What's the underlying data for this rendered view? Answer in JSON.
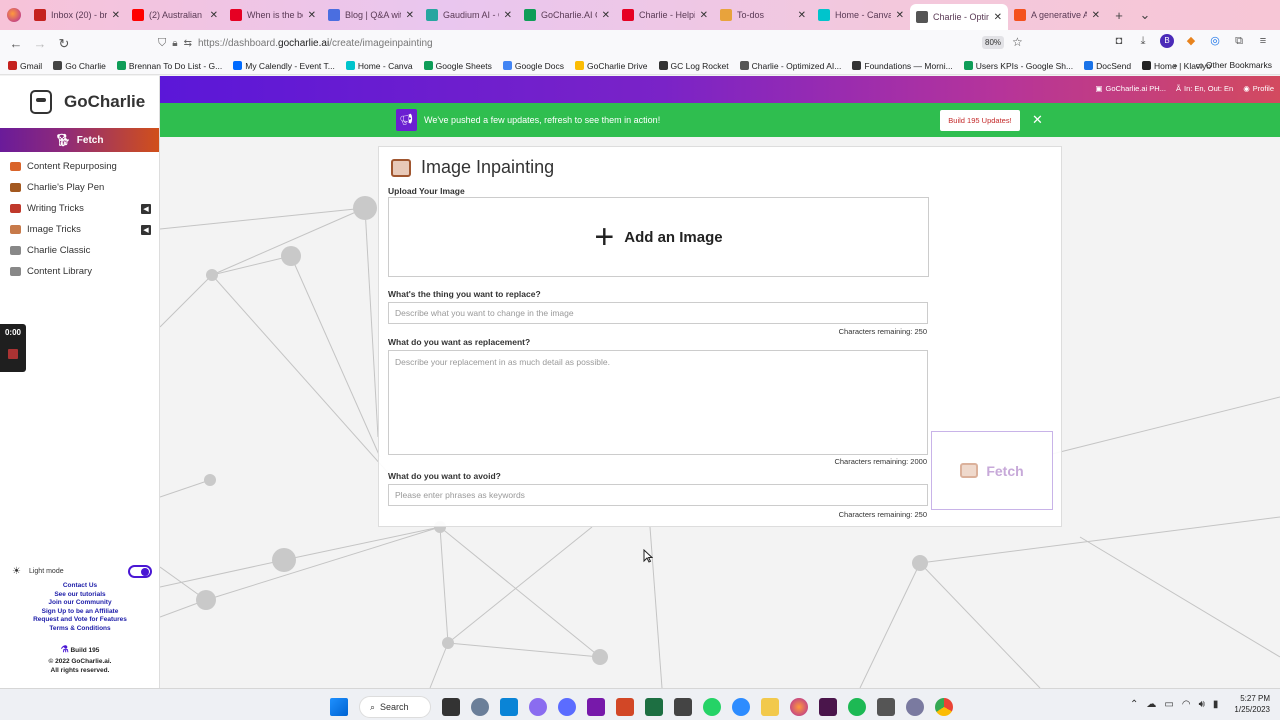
{
  "browser": {
    "tabs": [
      {
        "title": "Inbox (20) - bren",
        "color": "#c5221f"
      },
      {
        "title": "(2) Australian In",
        "color": "#ff0000"
      },
      {
        "title": "When is the best",
        "color": "#e60023"
      },
      {
        "title": "Blog | Q&A with",
        "color": "#4a6ee0"
      },
      {
        "title": "Gaudium AI - Ca",
        "color": "#26a6a0"
      },
      {
        "title": "GoCharlie.AI Co",
        "color": "#0f9d58"
      },
      {
        "title": "Charlie - Helpin",
        "color": "#e60023"
      },
      {
        "title": "To-dos",
        "color": "#e8a33c"
      },
      {
        "title": "Home - Canva",
        "color": "#00c4cc"
      },
      {
        "title": "Charlie - Optimi",
        "color": "#555555"
      },
      {
        "title": "A generative AI p",
        "color": "#f4511e"
      }
    ],
    "new_tab": "+",
    "tab_list": "⌄",
    "url_prefix": "https://dashboard.",
    "url_domain": "gocharlie.ai",
    "url_path": "/create/imageinpainting",
    "zoom": "80%",
    "bookmarks": [
      {
        "label": "Gmail",
        "color": "#c5221f"
      },
      {
        "label": "Go Charlie",
        "color": "#444444"
      },
      {
        "label": "Brennan To Do List - G...",
        "color": "#0f9d58"
      },
      {
        "label": "My Calendly - Event T...",
        "color": "#006bff"
      },
      {
        "label": "Home - Canva",
        "color": "#00c4cc"
      },
      {
        "label": "Google Sheets",
        "color": "#0f9d58"
      },
      {
        "label": "Google Docs",
        "color": "#4285f4"
      },
      {
        "label": "GoCharlie Drive",
        "color": "#fbbc04"
      },
      {
        "label": "GC Log Rocket",
        "color": "#333333"
      },
      {
        "label": "Charlie - Optimized AI...",
        "color": "#555555"
      },
      {
        "label": "Foundations — Morni...",
        "color": "#333333"
      },
      {
        "label": "Users KPIs - Google Sh...",
        "color": "#0f9d58"
      },
      {
        "label": "DocSend",
        "color": "#1a73e8"
      },
      {
        "label": "Home | Klaviyo",
        "color": "#222222"
      }
    ],
    "bookmarks_more": "»",
    "other_bookmarks": "Other Bookmarks"
  },
  "header": {
    "account": "GoCharlie.ai PH...",
    "language": "In: En, Out: En",
    "profile": "Profile"
  },
  "sidebar": {
    "brand": "GoCharlie",
    "fetch_label": "Fetch",
    "items": [
      {
        "label": "Content Repurposing",
        "color": "#d9642a"
      },
      {
        "label": "Charlie's Play Pen",
        "color": "#a3581f"
      },
      {
        "label": "Writing Tricks",
        "color": "#c0392b"
      },
      {
        "label": "Image Tricks",
        "color": "#c77a4a"
      },
      {
        "label": "Charlie Classic",
        "color": "#888888"
      },
      {
        "label": "Content Library",
        "color": "#888888"
      }
    ],
    "timer": "0:00",
    "light_mode": "Light mode",
    "links": [
      "Contact Us",
      "See our tutorials",
      "Join our Community",
      "Sign Up to be an Affiliate",
      "Request and Vote for Features",
      "Terms & Conditions"
    ],
    "build": "Build 195",
    "copyright_1": "© 2022 GoCharlie.ai.",
    "copyright_2": "All rights reserved."
  },
  "banner": {
    "message": "We've pushed a few updates, refresh to see them in action!",
    "button": "Build 195 Updates!",
    "close": "✕"
  },
  "form": {
    "title": "Image Inpainting",
    "upload_label": "Upload Your Image",
    "upload_button": "Add an Image",
    "replace_label": "What's the thing you want to replace?",
    "replace_placeholder": "Describe what you want to change in the image",
    "replace_remaining": "Characters remaining: 250",
    "replacement_label": "What do you want as replacement?",
    "replacement_placeholder": "Describe your replacement in as much detail as possible.",
    "replacement_remaining": "Characters remaining: 2000",
    "avoid_label": "What do you want to avoid?",
    "avoid_placeholder": "Please enter phrases as keywords",
    "avoid_remaining": "Characters remaining: 250",
    "fetch_button": "Fetch"
  },
  "taskbar": {
    "search": "Search",
    "time": "5:27 PM",
    "date": "1/25/2023"
  }
}
